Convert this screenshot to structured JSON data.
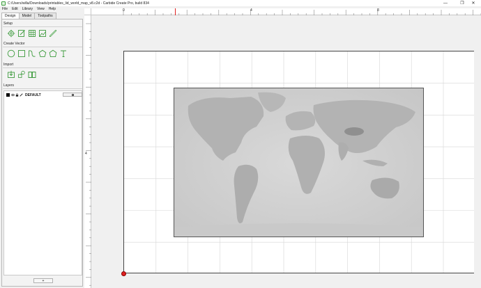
{
  "window": {
    "title": "C:/Users/willa/Downloads/printables_lid_world_map_v8.c2d - Carbide Create Pro, build 834",
    "minimize": "—",
    "maximize": "❐",
    "close": "✕"
  },
  "menu": [
    "File",
    "Edit",
    "Library",
    "View",
    "Help"
  ],
  "tabs": [
    "Design",
    "Model",
    "Toolpaths"
  ],
  "sections": {
    "setup": "Setup",
    "create_vector": "Create Vector",
    "import": "Import",
    "layers": "Layers"
  },
  "layers": {
    "name": "DEFAULT",
    "settings_icon": "gear-icon",
    "add_label": "+"
  },
  "ruler": {
    "h_labels": [
      "0",
      "4",
      "8"
    ],
    "v_labels": [
      "4"
    ]
  },
  "colors": {
    "accent": "#3c9b3c",
    "marker": "#e02020"
  }
}
